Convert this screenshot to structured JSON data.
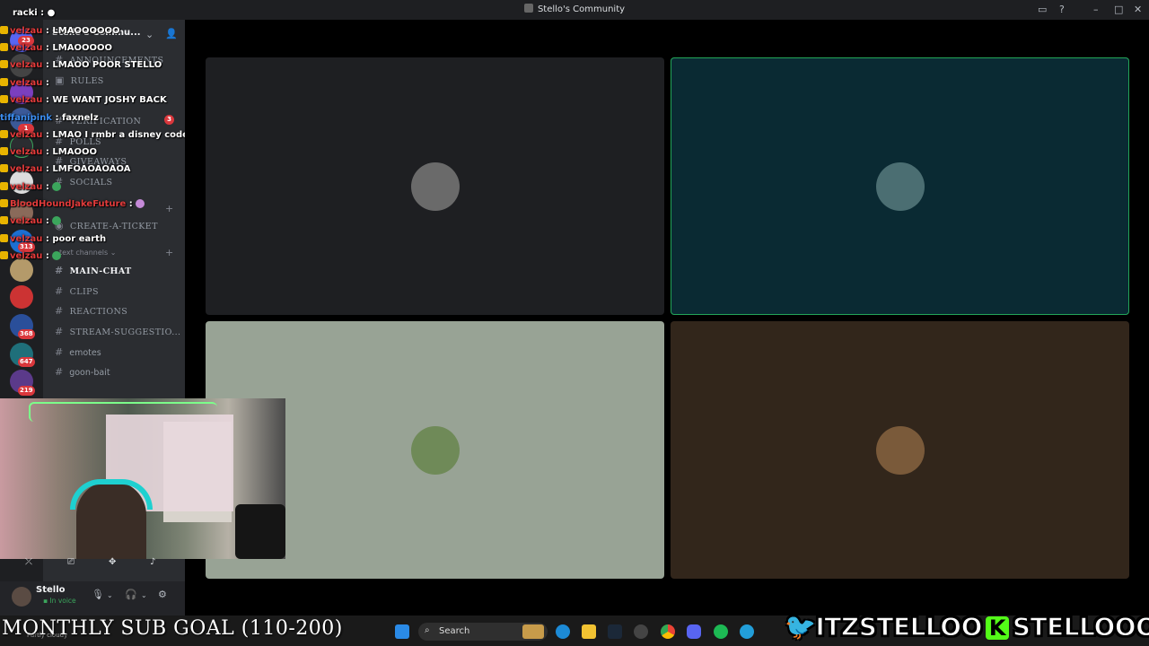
{
  "window": {
    "title": "Stello's Community"
  },
  "sidebar": {
    "server_name": "Stello's Commu...",
    "channels_top": [
      {
        "label": "ANNOUNCEMENTS"
      },
      {
        "label": "RULES"
      },
      {
        "label": "VERIFICATION"
      },
      {
        "label": "POLLS"
      },
      {
        "label": "GIVEAWAYS"
      },
      {
        "label": "SOCIALS"
      },
      {
        "label": "CREATE-A-TICKET"
      }
    ],
    "category_text": "text channels",
    "channels_text": [
      {
        "label": "MAIN-CHAT"
      },
      {
        "label": "CLIPS"
      },
      {
        "label": "REACTIONS"
      },
      {
        "label": "STREAM-SUGGESTIO..."
      },
      {
        "label": "emotes"
      },
      {
        "label": "goon-bait"
      }
    ],
    "unread_count": "3",
    "server_badges": [
      "23",
      "1",
      "313",
      "368",
      "647",
      "219"
    ]
  },
  "chat": [
    {
      "user": "racki",
      "msg": ""
    },
    {
      "user": "velzau",
      "msg": "LMAOOOOOO"
    },
    {
      "user": "velzau",
      "msg": "LMAOOOOO"
    },
    {
      "user": "velzau",
      "msg": "LMAOO POOR STELLO"
    },
    {
      "user": "velzau",
      "msg": ""
    },
    {
      "user": "velzau",
      "msg": "WE WANT JOSHY BACK"
    },
    {
      "user": "tiffanipink",
      "msg": "faxnelz"
    },
    {
      "user": "velzau",
      "msg": "LMAO I rmbr a disney code popped up on his live"
    },
    {
      "user": "velzau",
      "msg": "LMAOOO"
    },
    {
      "user": "velzau",
      "msg": "LMFOAOAOAOA"
    },
    {
      "user": "velzau",
      "msg": ""
    },
    {
      "user": "BloodHoundJakeFuture",
      "msg": ""
    },
    {
      "user": "velzau",
      "msg": ""
    },
    {
      "user": "velzau",
      "msg": "poor earth"
    },
    {
      "user": "velzau",
      "msg": ""
    }
  ],
  "user_panel": {
    "name": "Stello",
    "status": "In voice"
  },
  "video_tiles": [
    {
      "bg": "#1e1f22",
      "avatar": "#6a6a6a",
      "speaking": false
    },
    {
      "bg": "#0a2a33",
      "avatar": "#4b6e72",
      "speaking": true
    },
    {
      "bg": "#98a395",
      "avatar": "#6f8a58",
      "speaking": false
    },
    {
      "bg": "#32261b",
      "avatar": "#7a5a3a",
      "speaking": false
    }
  ],
  "overlay": {
    "sub_goal": "MONTHLY SUB GOAL (110-200)",
    "twitter_handle": "ITZSTELLOO",
    "kick_handle": "STELLOOO"
  },
  "taskbar": {
    "search_placeholder": "Search",
    "weather": "Partly cloudy"
  }
}
